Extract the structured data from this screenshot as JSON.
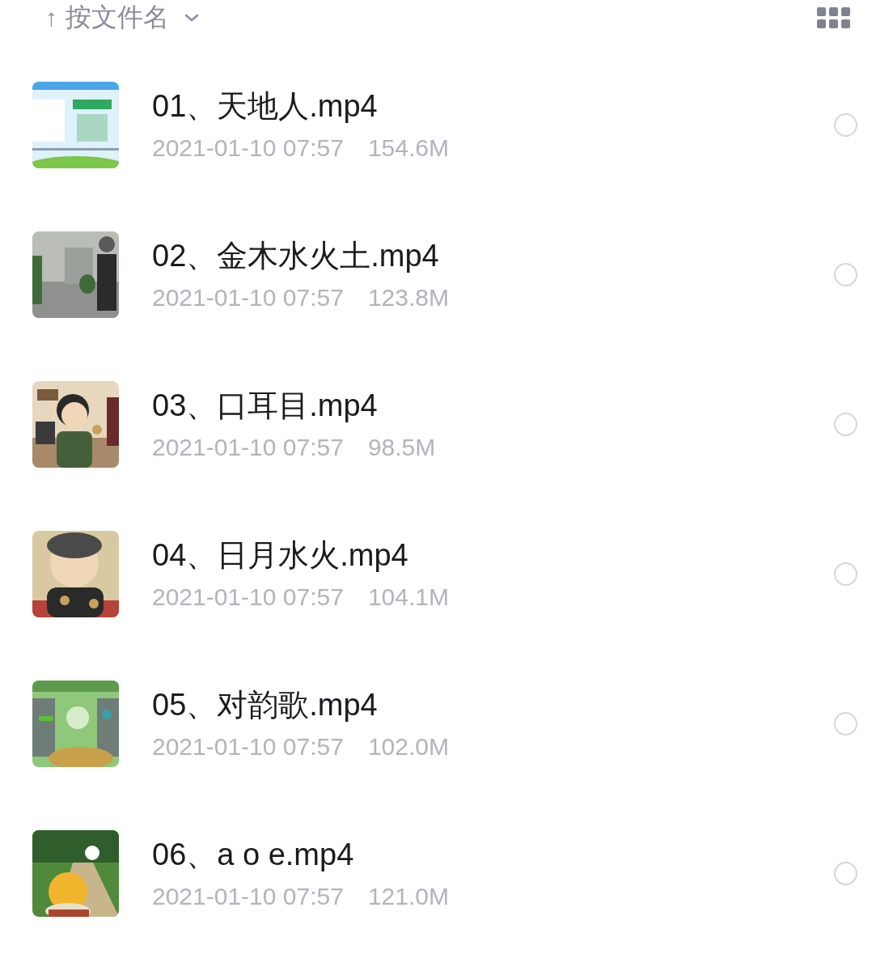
{
  "sort_bar": {
    "direction": "↑",
    "label": "按文件名"
  },
  "files": [
    {
      "name": "01、天地人.mp4",
      "modified": "2021-01-10 07:57",
      "size": "154.6M",
      "selected": false
    },
    {
      "name": "02、金木水火土.mp4",
      "modified": "2021-01-10 07:57",
      "size": "123.8M",
      "selected": false
    },
    {
      "name": "03、口耳目.mp4",
      "modified": "2021-01-10 07:57",
      "size": "98.5M",
      "selected": false
    },
    {
      "name": "04、日月水火.mp4",
      "modified": "2021-01-10 07:57",
      "size": "104.1M",
      "selected": false
    },
    {
      "name": "05、对韵歌.mp4",
      "modified": "2021-01-10 07:57",
      "size": "102.0M",
      "selected": false
    },
    {
      "name": "06、a o e.mp4",
      "modified": "2021-01-10 07:57",
      "size": "121.0M",
      "selected": false
    }
  ]
}
